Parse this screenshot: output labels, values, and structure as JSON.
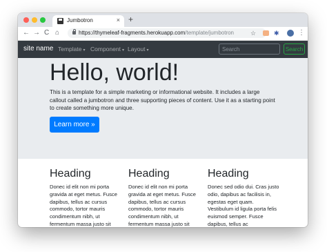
{
  "browser": {
    "tab_title": "Jumbotron",
    "tab_close": "×",
    "new_tab": "+",
    "url_host": "https://thymeleaf-fragments.herokuapp.com",
    "url_path": "/template/jumbotron",
    "nav": {
      "back": "←",
      "forward": "→",
      "reload": "C",
      "home": "⌂"
    },
    "icons": {
      "star": "☆",
      "extension": "✱",
      "menu": "⋮"
    }
  },
  "navbar": {
    "brand": "site name",
    "items": [
      {
        "label": "Template",
        "caret": "▾"
      },
      {
        "label": "Component",
        "caret": "▾"
      },
      {
        "label": "Layout",
        "caret": "▾"
      }
    ],
    "search_placeholder": "Search",
    "search_button": "Search"
  },
  "jumbotron": {
    "title": "Hello, world!",
    "text": "This is a template for a simple marketing or informational website. It includes a large callout called a jumbotron and three supporting pieces of content. Use it as a starting point to create something more unique.",
    "button": "Learn more »"
  },
  "columns": [
    {
      "heading": "Heading",
      "text": "Donec id elit non mi porta gravida at eget metus. Fusce dapibus, tellus ac cursus commodo, tortor mauris condimentum nibh, ut fermentum massa justo sit"
    },
    {
      "heading": "Heading",
      "text": "Donec id elit non mi porta gravida at eget metus. Fusce dapibus, tellus ac cursus commodo, tortor mauris condimentum nibh, ut fermentum massa justo sit"
    },
    {
      "heading": "Heading",
      "text": "Donec sed odio dui. Cras justo odio, dapibus ac facilisis in, egestas eget quam. Vestibulum id ligula porta felis euismod semper. Fusce dapibus, tellus ac"
    }
  ],
  "colors": {
    "navbar_bg": "#343a40",
    "jumbotron_bg": "#e9ecef",
    "primary": "#007bff",
    "success": "#28a745"
  }
}
